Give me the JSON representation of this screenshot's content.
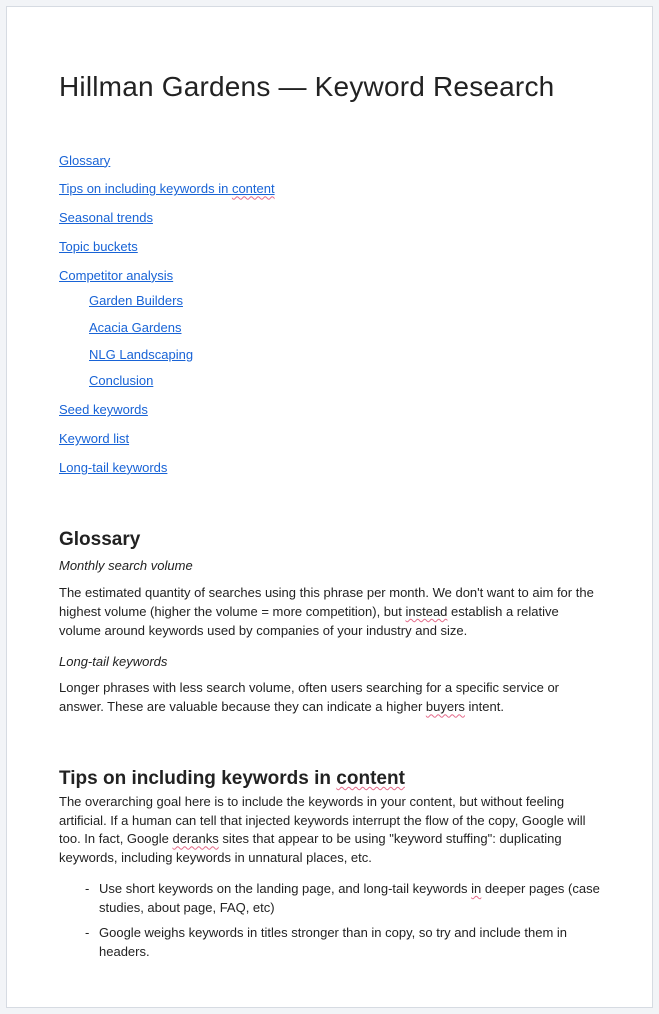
{
  "title": "Hillman Gardens — Keyword Research",
  "toc": {
    "glossary": "Glossary",
    "tips": "Tips on including keywords in ",
    "tips_squig": "content",
    "seasonal": "Seasonal trends",
    "topic_buckets": "Topic buckets",
    "competitor": "Competitor analysis",
    "competitor_sub": {
      "garden_builders": "Garden Builders",
      "acacia": "Acacia Gardens",
      "nlg": "NLG Landscaping",
      "conclusion": "Conclusion"
    },
    "seed": "Seed keywords",
    "keyword_list": "Keyword list",
    "long_tail": "Long-tail keywords"
  },
  "glossary": {
    "heading": "Glossary",
    "term1_label": "Monthly search volume",
    "term1_body_a": "The estimated quantity of searches using this phrase per month. We don't want to aim for the highest volume (higher the volume = more competition), but ",
    "term1_body_squig": "instead",
    "term1_body_b": " establish a relative volume around keywords used by companies of your industry and size.",
    "term2_label": "Long-tail keywords",
    "term2_body_a": "Longer phrases with less search volume, often users searching for a specific service or answer. These are valuable because they can indicate a higher ",
    "term2_body_squig": "buyers",
    "term2_body_b": " intent."
  },
  "tips": {
    "heading_a": "Tips on including keywords in ",
    "heading_squig": "content",
    "body_a": "The overarching goal here is to include the keywords in your content, but without feeling artificial. If a human can tell that injected keywords interrupt the flow of the copy, Google will too. In fact, Google ",
    "body_squig": "deranks",
    "body_b": " sites that appear to be using \"keyword stuffing\": duplicating keywords, including keywords in unnatural places, etc.",
    "bullet1_a": "Use short keywords on the landing page, and long-tail keywords ",
    "bullet1_squig": "in",
    "bullet1_b": " deeper pages (case studies, about page, FAQ, etc)",
    "bullet2": "Google weighs keywords in titles stronger than in copy, so try and include them in headers."
  }
}
